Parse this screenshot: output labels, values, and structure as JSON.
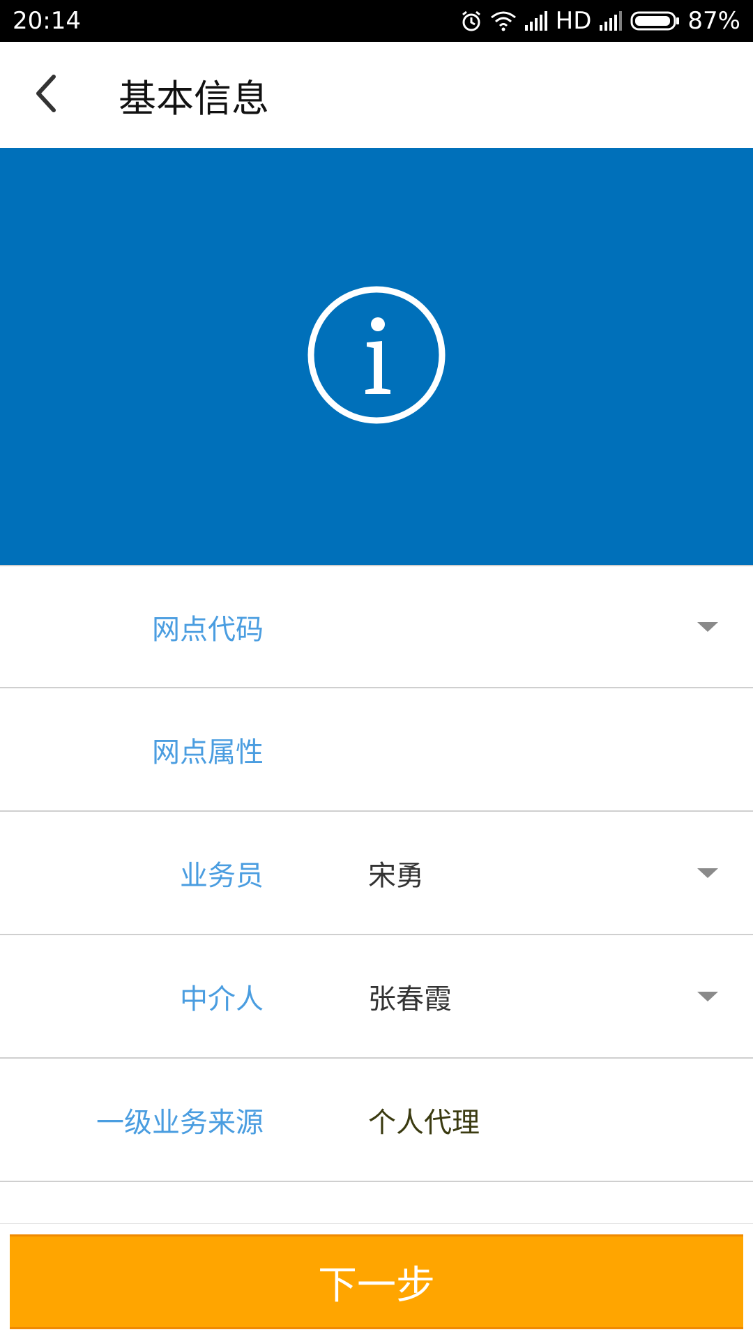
{
  "status_bar": {
    "time": "20:14",
    "network": "HD",
    "battery": "87%",
    "icons": [
      "alarm-icon",
      "wifi-icon",
      "signal-icon",
      "signal-icon",
      "battery-icon"
    ]
  },
  "header": {
    "title": "基本信息",
    "back_icon": "chevron-left-icon"
  },
  "banner": {
    "icon": "info-icon",
    "color": "#0070ba"
  },
  "form": {
    "rows": [
      {
        "label": "网点代码",
        "value": "",
        "has_dropdown": true
      },
      {
        "label": "网点属性",
        "value": "",
        "has_dropdown": false
      },
      {
        "label": "业务员",
        "value": "宋勇",
        "has_dropdown": true
      },
      {
        "label": "中介人",
        "value": "张春霞",
        "has_dropdown": true
      },
      {
        "label": "一级业务来源",
        "value": "个人代理",
        "has_dropdown": false
      }
    ]
  },
  "footer": {
    "next_label": "下一步",
    "button_color": "#ffa500"
  },
  "colors": {
    "label": "#4a9de0",
    "value": "#333333",
    "divider": "#cfcfcf"
  }
}
